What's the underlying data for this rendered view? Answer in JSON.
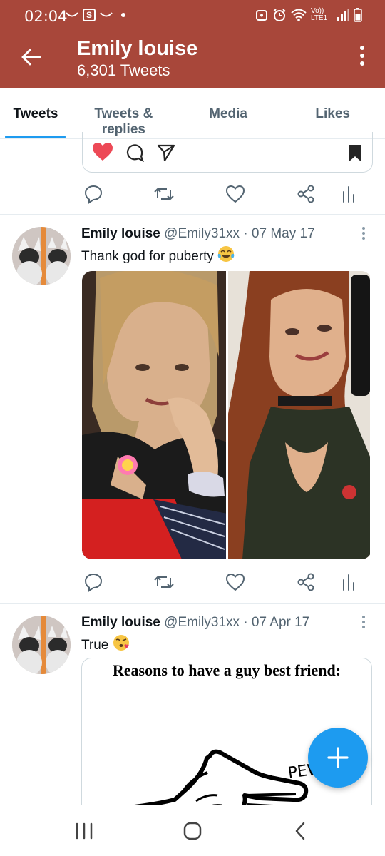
{
  "status_bar": {
    "time": "02:04",
    "left_icons": [
      "missed-call-icon",
      "s-app-icon",
      "missed-call-icon",
      "dot-icon"
    ],
    "right_icons": [
      "bixby-icon",
      "alarm-icon",
      "wifi-icon",
      "volte-icon",
      "signal-icon",
      "battery-icon"
    ],
    "volte_label": "Vo)) LTE1",
    "s_label": "S"
  },
  "header": {
    "title": "Emily louise",
    "subtitle": "6,301 Tweets",
    "color": "#a8473a"
  },
  "tabs": [
    {
      "label": "Tweets",
      "active": true
    },
    {
      "label": "Tweets & replies",
      "active": false
    },
    {
      "label": "Media",
      "active": false
    },
    {
      "label": "Likes",
      "active": false
    }
  ],
  "accent_color": "#1d9bf0",
  "tweets": [
    {
      "author": "Emily louise",
      "handle": "@Emily31xx",
      "separator": "·",
      "date": "07 May 17",
      "text": "Thank god for puberty",
      "emoji": "tears-of-joy-emoji",
      "media": [
        "photo-before",
        "photo-after"
      ]
    },
    {
      "author": "Emily louise",
      "handle": "@Emily31xx",
      "separator": "·",
      "date": "07 Apr 17",
      "text": "True",
      "emoji": "kissing-face-emoji",
      "media_caption": "Reasons to have a guy best friend:",
      "media_sound_text": "PEW PEW!"
    }
  ],
  "fab_icon": "plus-icon",
  "nav": [
    "recent-apps-icon",
    "home-icon",
    "back-nav-icon"
  ]
}
